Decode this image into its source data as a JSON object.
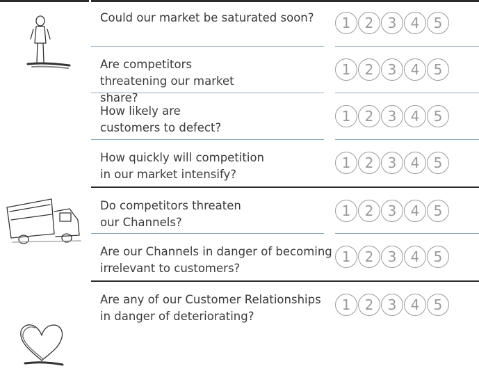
{
  "questions": [
    {
      "text": "Could our market be saturated soon?",
      "options": [
        "1",
        "2",
        "3",
        "4",
        "5"
      ]
    },
    {
      "text": "Are competitors threatening our market share?",
      "options": [
        "1",
        "2",
        "3",
        "4",
        "5"
      ]
    },
    {
      "text": "How likely are customers to defect?",
      "options": [
        "1",
        "2",
        "3",
        "4",
        "5"
      ]
    },
    {
      "text": "How quickly will competition in our market intensify?",
      "options": [
        "1",
        "2",
        "3",
        "4",
        "5"
      ]
    },
    {
      "text": "Do competitors threaten our Channels?",
      "options": [
        "1",
        "2",
        "3",
        "4",
        "5"
      ]
    },
    {
      "text": "Are our Channels in danger of becoming irrelevant to customers?",
      "options": [
        "1",
        "2",
        "3",
        "4",
        "5"
      ]
    },
    {
      "text": "Are any of our Customer Relationships in danger of deteriorating?",
      "options": [
        "1",
        "2",
        "3",
        "4",
        "5"
      ]
    }
  ],
  "icons": [
    "person-sketch-icon",
    "truck-sketch-icon",
    "heart-sketch-icon"
  ],
  "colors": {
    "text": "#3a3a3a",
    "rating_circle": "#9a9a9a",
    "row_separator": "#8ea8bf",
    "section_rule": "#2b2b2b"
  }
}
